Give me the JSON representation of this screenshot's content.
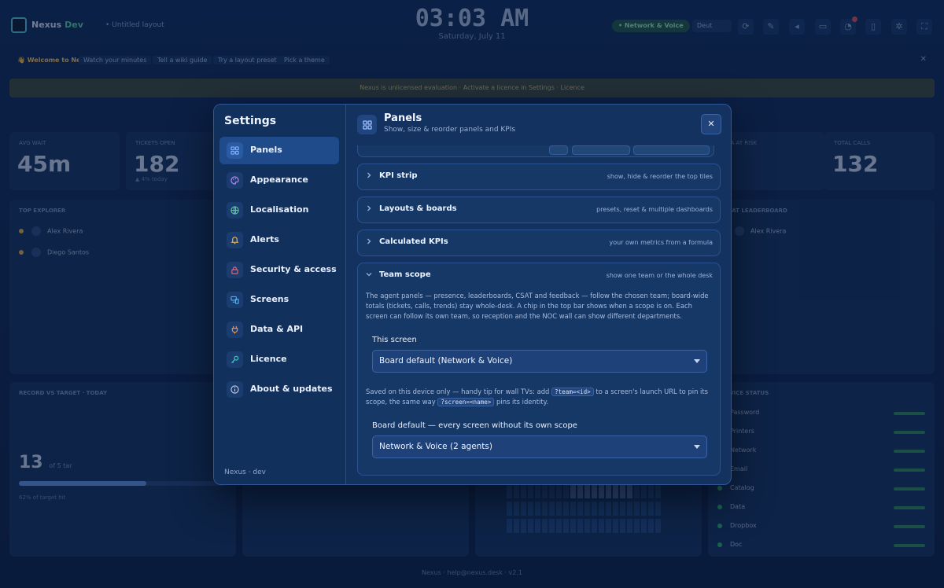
{
  "background": {
    "brand": "Nexus",
    "brand_tag": "Dev",
    "workspace": "• Untitled layout",
    "clock": "03:03 AM",
    "date": "Saturday, July 11",
    "scope_chip": "• Network & Voice",
    "language": "Deut",
    "welcome": {
      "title": "👋 Welcome to Nexus",
      "items": [
        "Watch your minutes",
        "Tell a wiki guide",
        "Try a layout preset",
        "Pick a theme"
      ]
    },
    "licence_banner": "Nexus is unlicensed evaluation · Activate a licence in Settings · Licence",
    "kpis": [
      {
        "label": "AVG WAIT",
        "value": "45m",
        "sub": ""
      },
      {
        "label": "TICKETS OPEN",
        "value": "182",
        "sub": "▲ 4% today"
      },
      {
        "label": "SLA AT RISK",
        "value": "",
        "sub": ""
      },
      {
        "label": "TOTAL CALLS",
        "value": "132",
        "sub": ""
      }
    ],
    "panels": {
      "explorer_title": "TOP EXPLORER",
      "explorer_rows": [
        "Alex Rivera",
        "Diego Santos"
      ],
      "leader_title": "CSAT LEADERBOARD",
      "leader_rows": [
        "Alex Rivera"
      ],
      "target_title": "RECORD VS TARGET · TODAY",
      "target_value": "13",
      "target_unit": "of 5 tar",
      "target_sub": "62% of target hit",
      "status_title": "SERVICE STATUS",
      "status_rows": [
        "Password",
        "Printers",
        "Network",
        "Email",
        "Catalog",
        "Data",
        "Dropbox",
        "Doc"
      ]
    },
    "footer": "Nexus · help@nexus.desk · v2.1"
  },
  "modal": {
    "title": "Settings",
    "nav": [
      {
        "label": "Panels",
        "icon": "grid-icon",
        "color": "#6ea2ff"
      },
      {
        "label": "Appearance",
        "icon": "palette-icon",
        "color": "#c48cff"
      },
      {
        "label": "Localisation",
        "icon": "globe-icon",
        "color": "#4fd18f"
      },
      {
        "label": "Alerts",
        "icon": "bell-icon",
        "color": "#f2c14e"
      },
      {
        "label": "Security & access",
        "icon": "lock-icon",
        "color": "#f06a7a"
      },
      {
        "label": "Screens",
        "icon": "screens-icon",
        "color": "#4fb6f2"
      },
      {
        "label": "Data & API",
        "icon": "plug-icon",
        "color": "#f2994e"
      },
      {
        "label": "Licence",
        "icon": "key-icon",
        "color": "#3fd0c4"
      },
      {
        "label": "About & updates",
        "icon": "info-icon",
        "color": "#c8d2e6"
      }
    ],
    "footer": "Nexus · dev",
    "header": {
      "title": "Panels",
      "subtitle": "Show, size & reorder panels and KPIs"
    },
    "sections": [
      {
        "title": "KPI strip",
        "hint": "show, hide & reorder the top tiles"
      },
      {
        "title": "Layouts & boards",
        "hint": "presets, reset & multiple dashboards"
      },
      {
        "title": "Calculated KPIs",
        "hint": "your own metrics from a formula"
      }
    ],
    "team_scope": {
      "title": "Team scope",
      "hint": "show one team or the whole desk",
      "description": "The agent panels — presence, leaderboards, CSAT and feedback — follow the chosen team; board-wide totals (tickets, calls, trends) stay whole-desk. A chip in the top bar shows when a scope is on. Each screen can follow its own team, so reception and the NOC wall can show different departments.",
      "this_screen_label": "This screen",
      "this_screen_value": "Board default (Network & Voice)",
      "tip_before": "Saved on this device only — handy tip for wall TVs: add ",
      "tip_code1": "?team=<id>",
      "tip_middle": " to a screen's launch URL to pin its scope, the same way ",
      "tip_code2": "?screen=<name>",
      "tip_after": " pins its identity.",
      "board_default_label": "Board default — every screen without its own scope",
      "board_default_value": "Network & Voice (2 agents)"
    }
  }
}
